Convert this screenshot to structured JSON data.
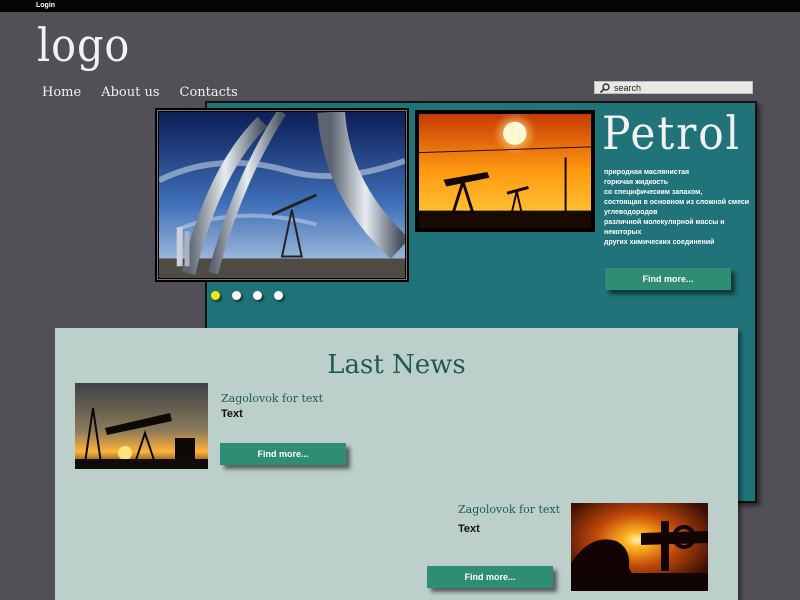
{
  "header": {
    "login_label": "Login",
    "logo_text": "logo"
  },
  "nav": {
    "items": [
      {
        "label": "Home"
      },
      {
        "label": "About us"
      },
      {
        "label": "Contacts"
      }
    ]
  },
  "search": {
    "placeholder": "search",
    "value": ""
  },
  "hero": {
    "title": "Petrol",
    "description_lines": [
      "природная маслянистая",
      "горючая жидкость",
      "со специфическим запахом,",
      "состоящая в основном из сложной смеси",
      "углеводородов",
      "различной молекулярной массы и",
      "некоторых",
      "других химических соединений"
    ],
    "button_label": "Find more...",
    "slider": {
      "count": 4,
      "active_index": 0,
      "active_color": "#f5ea10"
    }
  },
  "news": {
    "title": "Last News",
    "items": [
      {
        "heading": "Zagolovok for text",
        "text": "Text",
        "button_label": "Find more..."
      },
      {
        "heading": "Zagolovok for text",
        "text": "Text",
        "button_label": "Find more..."
      }
    ]
  },
  "colors": {
    "page_background": "#534f57",
    "hero_panel": "#21737a",
    "news_panel": "#bccfca",
    "button": "#2e8d72",
    "news_heading": "#1f5a52"
  },
  "icons": {
    "search": "magnifier-icon"
  }
}
